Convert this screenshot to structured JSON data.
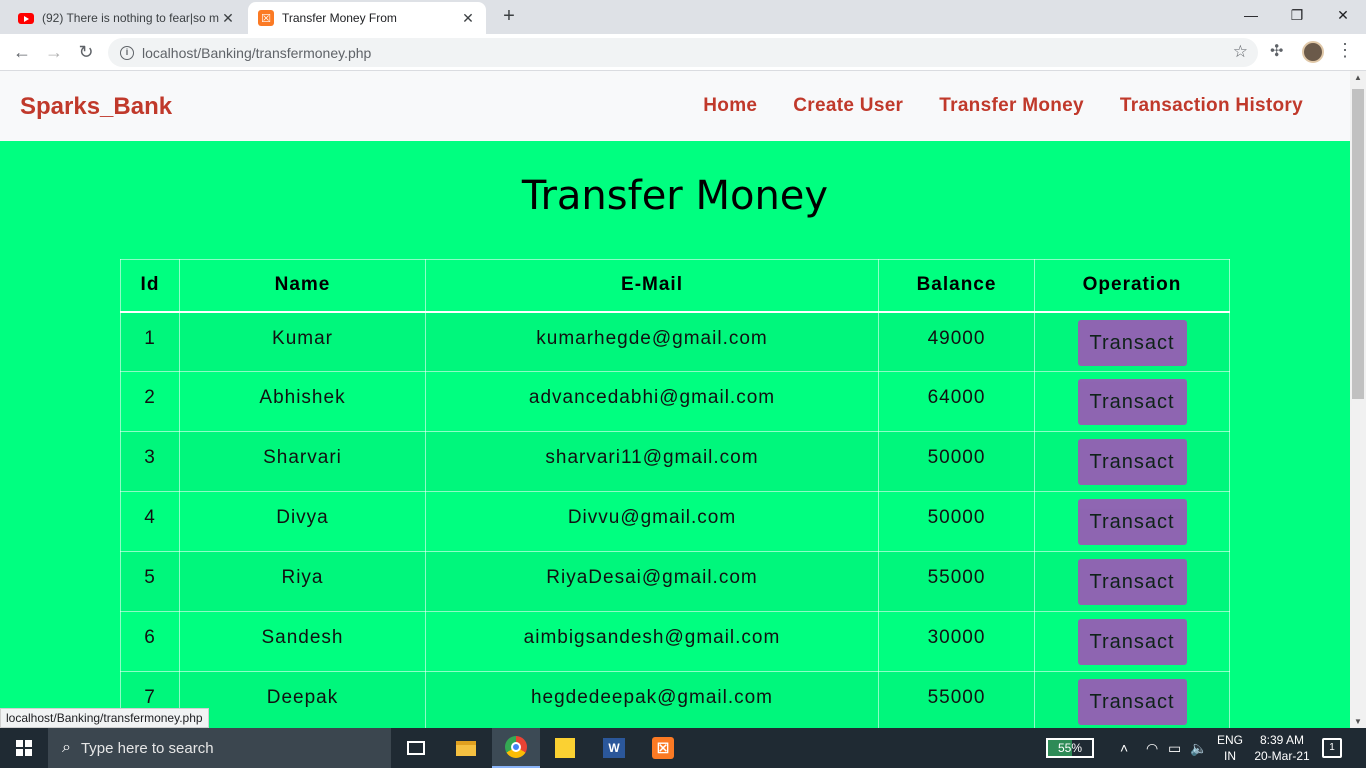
{
  "browser": {
    "tabs": [
      {
        "title": "(92) There is nothing to fear|so m",
        "favicon": "youtube-icon",
        "active": false
      },
      {
        "title": "Transfer Money From",
        "favicon": "xampp-icon",
        "active": true
      }
    ],
    "new_tab": "+",
    "url": "localhost/Banking/transfermoney.php",
    "status_url": "localhost/Banking/transfermoney.php"
  },
  "navbar": {
    "brand": "Sparks_Bank",
    "links": [
      "Home",
      "Create User",
      "Transfer Money",
      "Transaction History"
    ]
  },
  "page": {
    "title": "Transfer Money"
  },
  "table": {
    "headers": [
      "Id",
      "Name",
      "E-Mail",
      "Balance",
      "Operation"
    ],
    "rows": [
      {
        "id": "1",
        "name": "Kumar",
        "email": "kumarhegde@gmail.com",
        "balance": "49000",
        "action": "Transact"
      },
      {
        "id": "2",
        "name": "Abhishek",
        "email": "advancedabhi@gmail.com",
        "balance": "64000",
        "action": "Transact"
      },
      {
        "id": "3",
        "name": "Sharvari",
        "email": "sharvari11@gmail.com",
        "balance": "50000",
        "action": "Transact"
      },
      {
        "id": "4",
        "name": "Divya",
        "email": "Divvu@gmail.com",
        "balance": "50000",
        "action": "Transact"
      },
      {
        "id": "5",
        "name": "Riya",
        "email": "RiyaDesai@gmail.com",
        "balance": "55000",
        "action": "Transact"
      },
      {
        "id": "6",
        "name": "Sandesh",
        "email": "aimbigsandesh@gmail.com",
        "balance": "30000",
        "action": "Transact"
      },
      {
        "id": "7",
        "name": "Deepak",
        "email": "hegdedeepak@gmail.com",
        "balance": "55000",
        "action": "Transact"
      }
    ]
  },
  "taskbar": {
    "search_placeholder": "Type here to search",
    "battery": "55%",
    "battery_level": 0.55,
    "lang_top": "ENG",
    "lang_bottom": "IN",
    "time": "8:39 AM",
    "date": "20-Mar-21",
    "notification_count": "1"
  },
  "colors": {
    "page_bg": "#00ff80",
    "brand": "#c0392b",
    "button": "#9b59b6"
  }
}
